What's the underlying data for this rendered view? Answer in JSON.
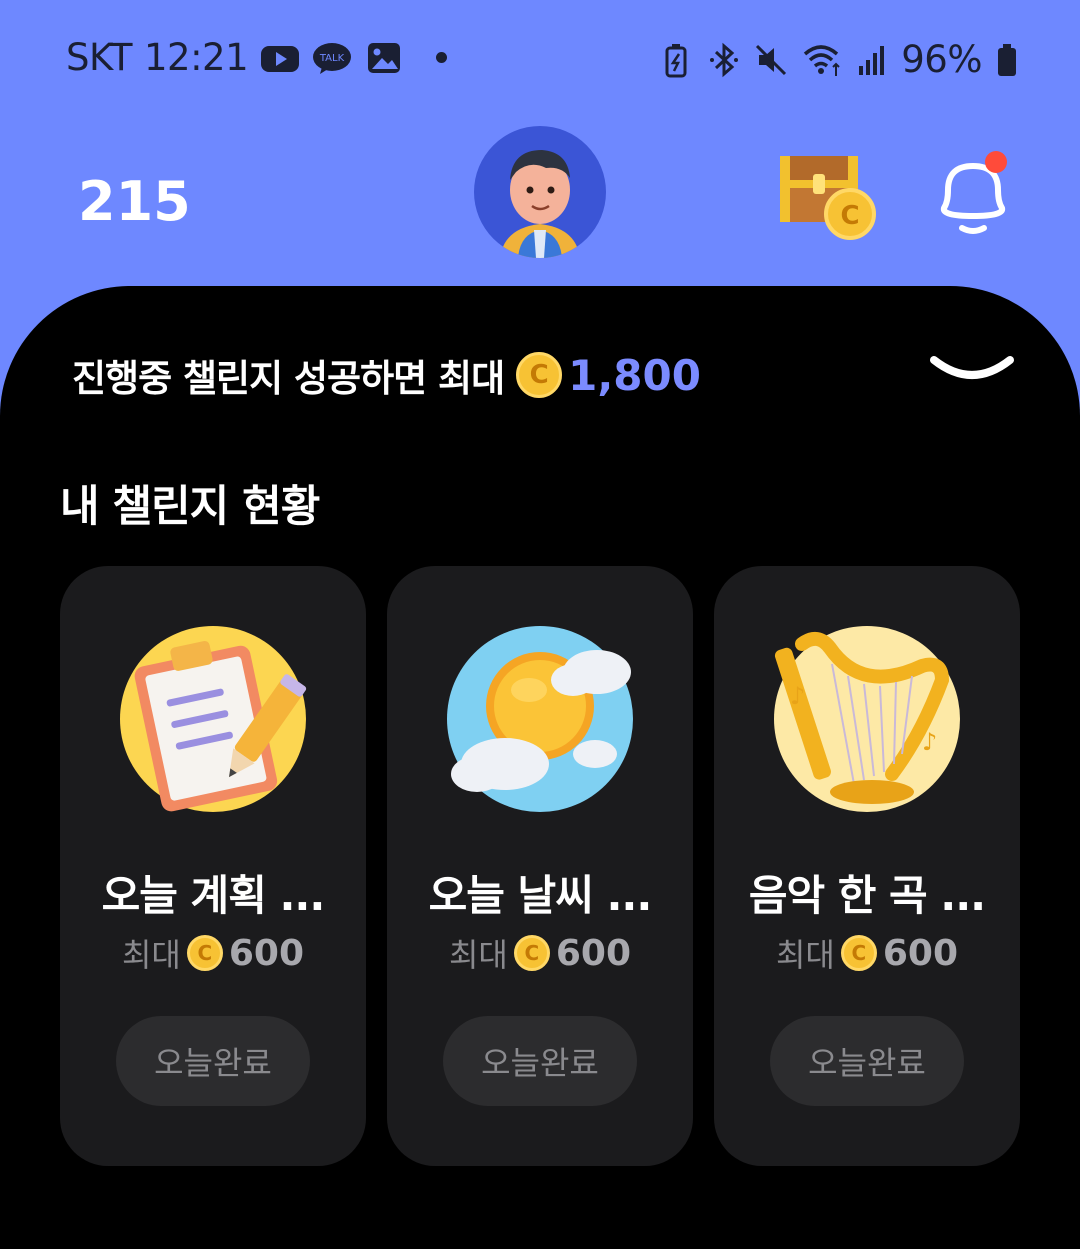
{
  "status_bar": {
    "carrier": "SKT",
    "time": "12:21",
    "battery": "96%"
  },
  "header": {
    "points": "215"
  },
  "banner": {
    "text": "진행중 챌린지 성공하면 최대",
    "coin_symbol": "C",
    "amount": "1,800"
  },
  "section_title": "내 챌린지 현황",
  "challenges": [
    {
      "title": "오늘 계획 ...",
      "reward_label": "최대",
      "coin_symbol": "C",
      "reward": "600",
      "button": "오늘완료",
      "icon": "clipboard-icon"
    },
    {
      "title": "오늘 날씨 ...",
      "reward_label": "최대",
      "coin_symbol": "C",
      "reward": "600",
      "button": "오늘완료",
      "icon": "sun-cloud-icon"
    },
    {
      "title": "음악 한 곡 ...",
      "reward_label": "최대",
      "coin_symbol": "C",
      "reward": "600",
      "button": "오늘완료",
      "icon": "harp-icon"
    }
  ],
  "colors": {
    "header_bg": "#6e88ff",
    "panel_bg": "#000000",
    "card_bg": "#1b1b1d",
    "accent_amount": "#7b8bff",
    "coin": "#f7c234",
    "notification_dot": "#ff4b3a"
  }
}
